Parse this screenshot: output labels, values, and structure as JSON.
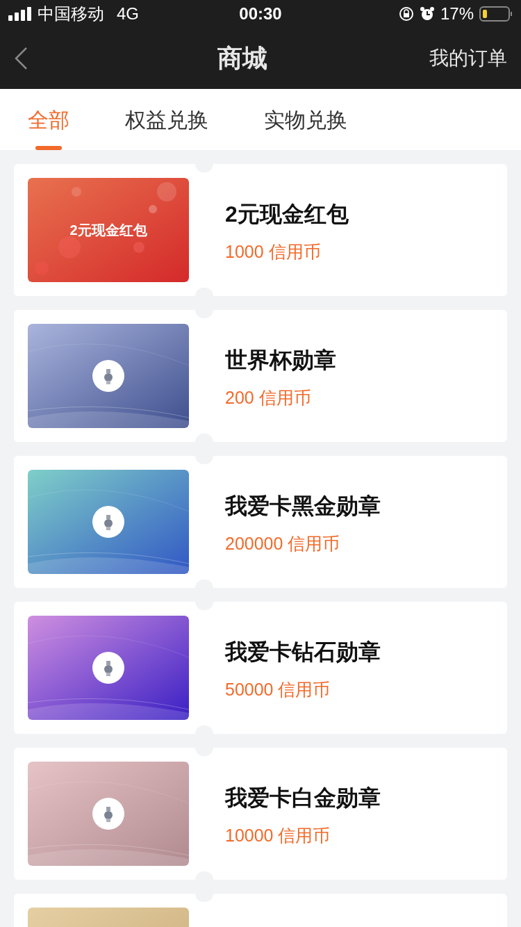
{
  "status_bar": {
    "carrier": "中国移动",
    "network": "4G",
    "time": "00:30",
    "battery": "17%"
  },
  "header": {
    "title": "商城",
    "action": "我的订单"
  },
  "tabs": [
    {
      "label": "全部",
      "selected": true
    },
    {
      "label": "权益兑换",
      "selected": false
    },
    {
      "label": "实物兑换",
      "selected": false
    }
  ],
  "products": [
    {
      "kind": "cash",
      "image_label": "2元现金红包",
      "title": "2元现金红包",
      "price": "1000 信用币"
    },
    {
      "kind": "medal",
      "title": "世界杯勋章",
      "price": "200 信用币"
    },
    {
      "kind": "medal",
      "title": "我爱卡黑金勋章",
      "price": "200000 信用币"
    },
    {
      "kind": "medal",
      "title": "我爱卡钻石勋章",
      "price": "50000 信用币"
    },
    {
      "kind": "medal",
      "title": "我爱卡白金勋章",
      "price": "10000 信用币"
    },
    {
      "kind": "partial"
    }
  ]
}
